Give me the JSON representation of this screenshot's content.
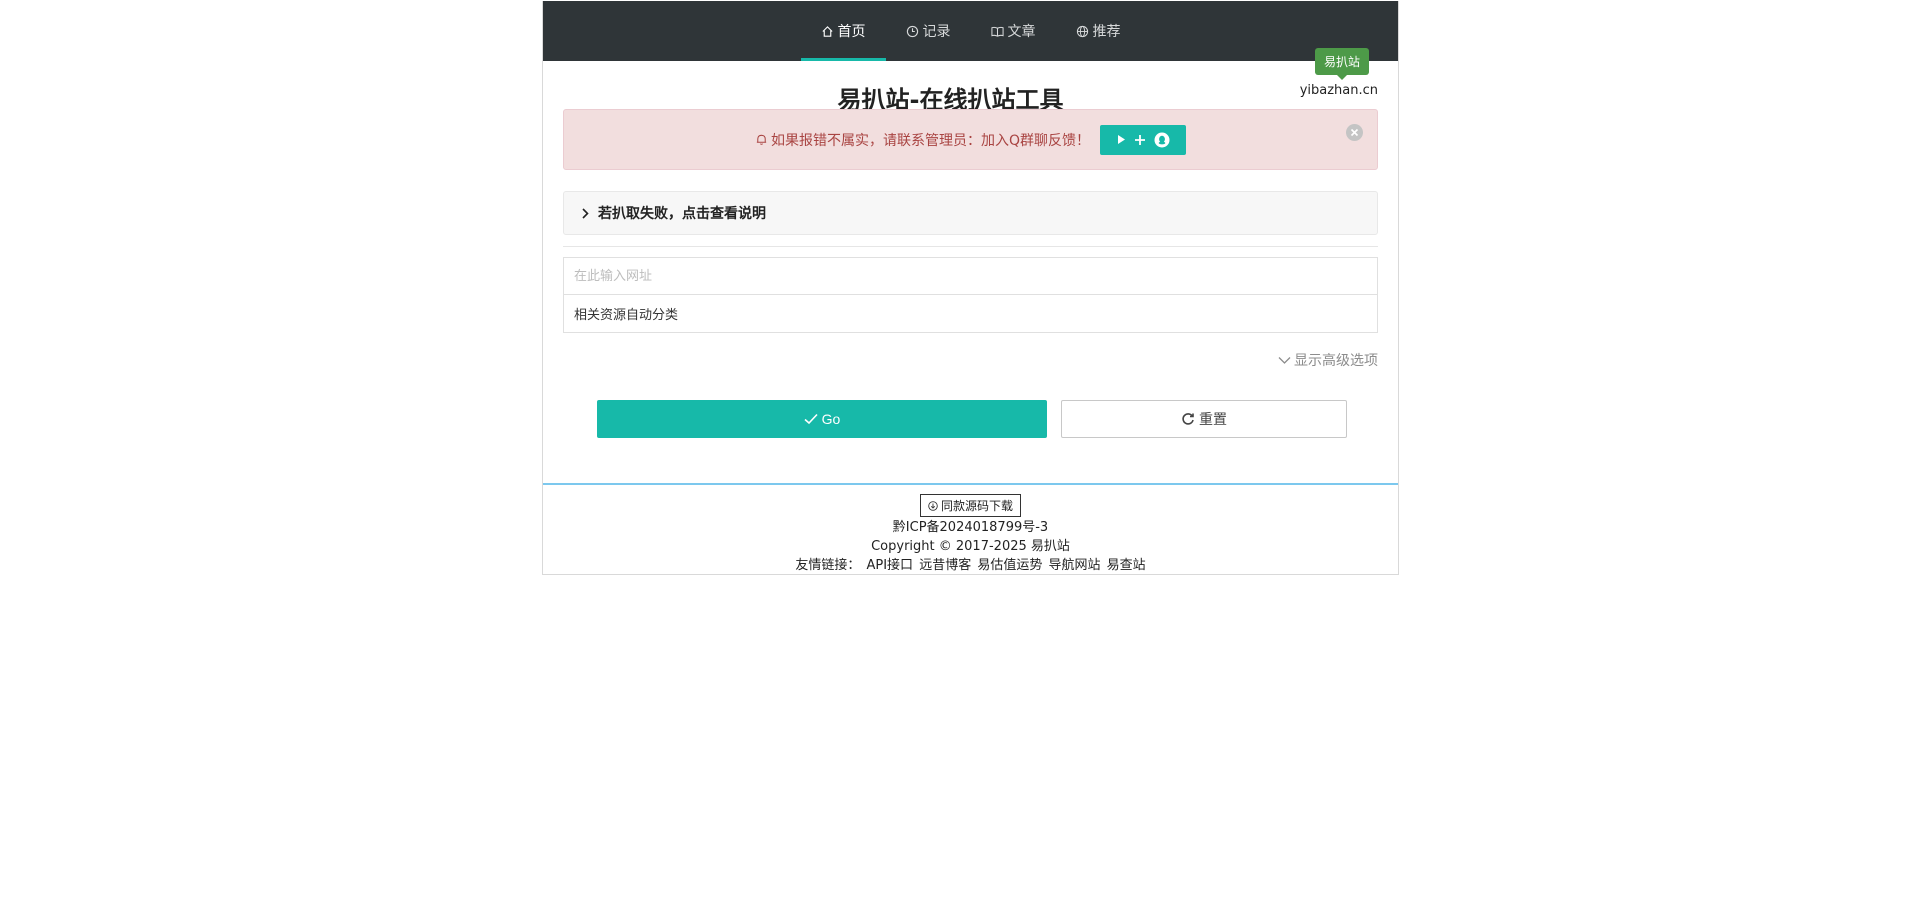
{
  "nav": {
    "items": [
      {
        "label": "首页",
        "icon": "home-icon"
      },
      {
        "label": "记录",
        "icon": "clock-icon"
      },
      {
        "label": "文章",
        "icon": "book-icon"
      },
      {
        "label": "推荐",
        "icon": "globe-icon"
      }
    ],
    "active_index": 0
  },
  "brand": {
    "tag": "易扒站",
    "domain": "yibazhan.cn"
  },
  "title": "易扒站-在线扒站工具",
  "alert": {
    "text": "如果报错不属实，请联系管理员：加入Q群聊反馈！",
    "icon": "bell-icon",
    "join_icons": [
      "play-icon",
      "plus-icon",
      "qq-icon"
    ]
  },
  "collapse": {
    "label": "若扒取失败，点击查看说明"
  },
  "form": {
    "url_placeholder": "在此输入网址",
    "category_value": "相关资源自动分类",
    "advanced_label": "显示高级选项"
  },
  "buttons": {
    "go": "Go",
    "reset": "重置"
  },
  "footer": {
    "source_label": "同款源码下载",
    "icp": "黔ICP备2024018799号-3",
    "copyright": "Copyright © 2017-2025 易扒站",
    "links_label": "友情链接：",
    "links": [
      "API接口",
      "远昔博客",
      "易估值运势",
      "导航网站",
      "易查站"
    ]
  },
  "colors": {
    "nav_bg": "#2f3538",
    "accent": "#17b9a9",
    "alert_bg": "#f2dede",
    "alert_text": "#a94442",
    "brand_tag": "#4d9a48"
  }
}
